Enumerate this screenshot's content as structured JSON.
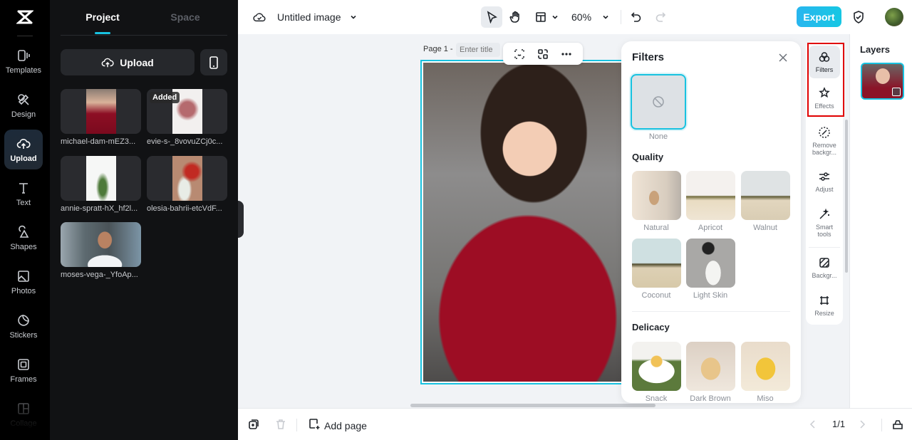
{
  "rail": {
    "items": [
      {
        "label": "Templates",
        "icon": "templates-icon"
      },
      {
        "label": "Design",
        "icon": "design-icon"
      },
      {
        "label": "Upload",
        "icon": "upload-cloud-icon",
        "active": true
      },
      {
        "label": "Text",
        "icon": "text-icon"
      },
      {
        "label": "Shapes",
        "icon": "shapes-icon"
      },
      {
        "label": "Photos",
        "icon": "photos-icon"
      },
      {
        "label": "Stickers",
        "icon": "stickers-icon"
      },
      {
        "label": "Frames",
        "icon": "frames-icon"
      },
      {
        "label": "Collage",
        "icon": "collage-icon"
      }
    ]
  },
  "panel": {
    "tabs": [
      {
        "label": "Project",
        "active": true
      },
      {
        "label": "Space",
        "active": false
      }
    ],
    "upload_label": "Upload",
    "assets": [
      {
        "name": "michael-dam-mEZ3...",
        "badge": ""
      },
      {
        "name": "evie-s-_8vovuZCj0c...",
        "badge": "Added"
      },
      {
        "name": "annie-spratt-hX_hf2l...",
        "badge": ""
      },
      {
        "name": "olesia-bahrii-etcVdF...",
        "badge": ""
      },
      {
        "name": "moses-vega-_YfoAp...",
        "badge": ""
      }
    ]
  },
  "topbar": {
    "doc_title": "Untitled image",
    "zoom": "60%",
    "export_label": "Export"
  },
  "canvas": {
    "page_label": "Page 1 -",
    "title_placeholder": "Enter title"
  },
  "filters": {
    "title": "Filters",
    "none_label": "None",
    "sections": [
      {
        "title": "Quality",
        "items": [
          "Natural",
          "Apricot",
          "Walnut",
          "Coconut",
          "Light Skin"
        ]
      },
      {
        "title": "Delicacy",
        "items": [
          "Snack",
          "Dark Brown",
          "Miso"
        ]
      }
    ]
  },
  "tools": {
    "items": [
      {
        "label": "Filters",
        "active": true
      },
      {
        "label": "Effects"
      },
      {
        "label": "Remove backgr..."
      },
      {
        "label": "Adjust"
      },
      {
        "label": "Smart tools"
      },
      {
        "label": "Backgr..."
      },
      {
        "label": "Resize"
      }
    ]
  },
  "layers": {
    "title": "Layers"
  },
  "bottombar": {
    "add_page_label": "Add page",
    "page_counter": "1/1"
  },
  "colors": {
    "accent": "#18c2e0",
    "highlight": "#e00000",
    "sweater": "#9d0d24"
  }
}
